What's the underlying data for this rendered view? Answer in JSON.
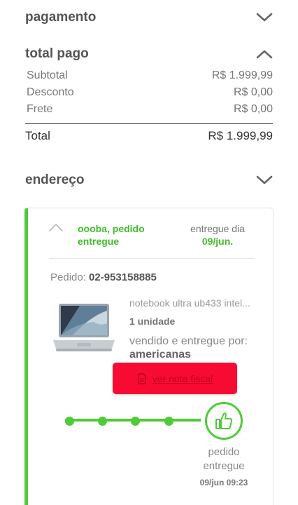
{
  "sections": {
    "payment": {
      "title": "pagamento",
      "icon": "chevron-down-icon"
    },
    "total_paid": {
      "title": "total pago",
      "icon": "chevron-up-icon"
    },
    "address": {
      "title": "endereço",
      "icon": "chevron-down-icon"
    }
  },
  "summary": {
    "rows": [
      {
        "label": "Subtotal",
        "value": "R$ 1.999,99"
      },
      {
        "label": "Desconto",
        "value": "R$ 0,00"
      },
      {
        "label": "Frete",
        "value": "R$ 0,00"
      }
    ],
    "total_label": "Total",
    "total_value": "R$ 1.999,99"
  },
  "order_card": {
    "status_text": "oooba, pedido entregue",
    "delivered_label": "entregue dia",
    "delivered_date": "09/jun.",
    "order_label": "Pedido:",
    "order_number": "02-953158885",
    "product": {
      "name": "notebook ultra ub433 intel...",
      "quantity": "1 unidade",
      "seller_label": "vendido e entregue por:",
      "seller_name": "americanas"
    },
    "invoice_button": "ver nota fiscal",
    "timeline": {
      "final_label": "pedido entregue",
      "final_time": "09/jun 09:23",
      "final_icon": "thumbs-up-icon"
    }
  },
  "colors": {
    "accent_green": "#4fcb3a",
    "button_red": "#f80b32",
    "text_gray": "#555555"
  }
}
